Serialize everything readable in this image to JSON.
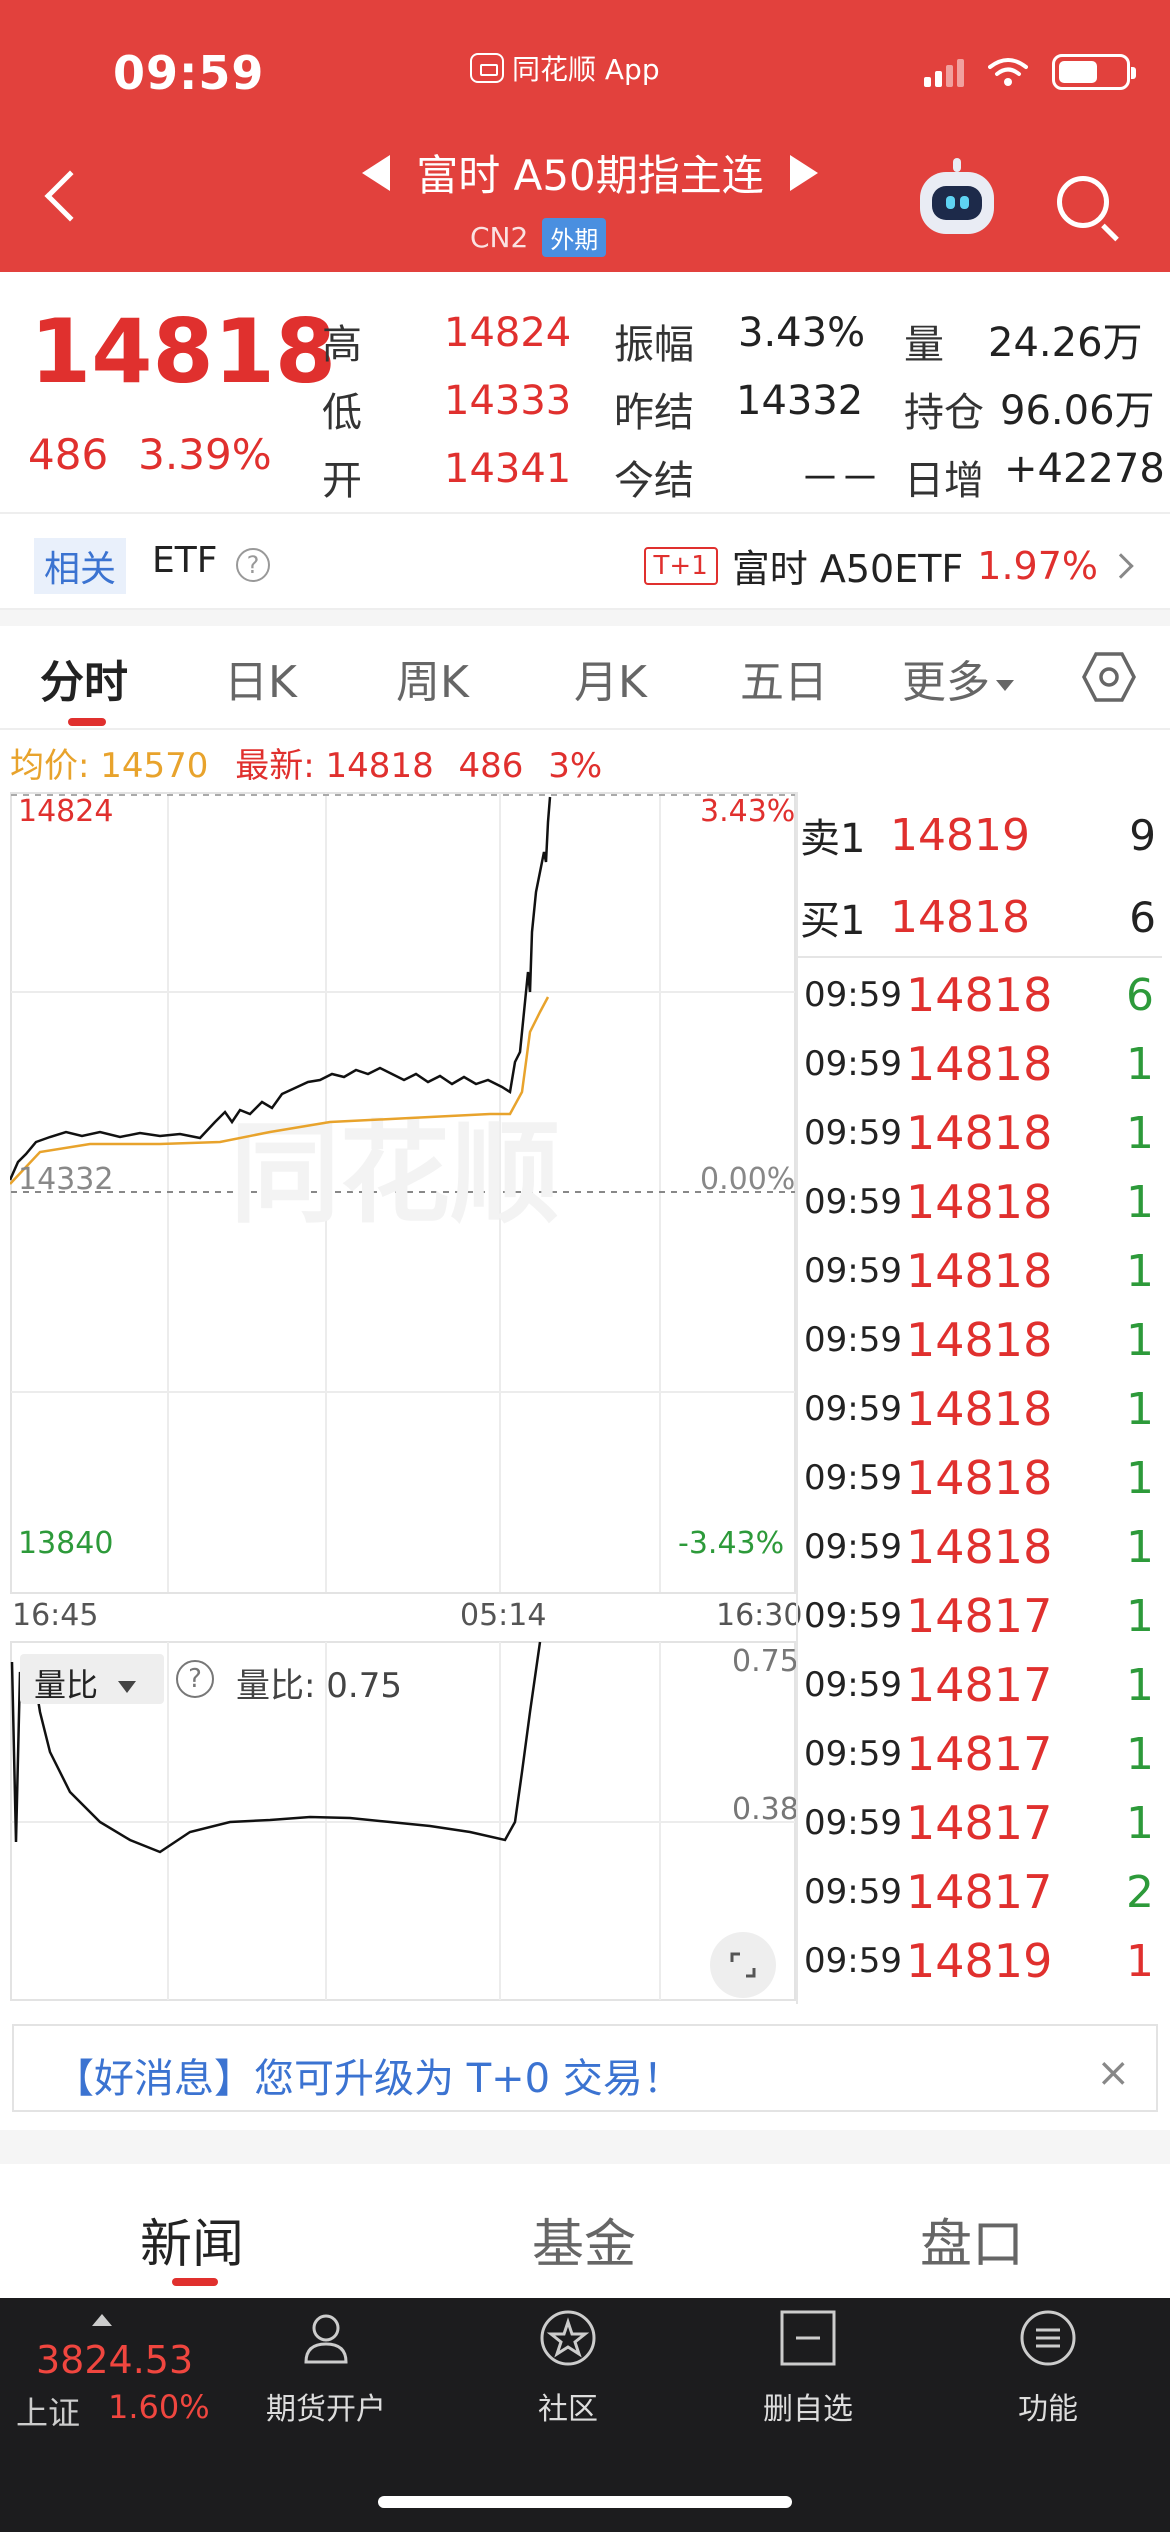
{
  "status": {
    "time": "09:59",
    "app": "同花顺 App"
  },
  "nav": {
    "title": "富时 A50期指主连",
    "code": "CN2",
    "tag": "外期"
  },
  "quote": {
    "price": "14818",
    "change": "486",
    "change_pct": "3.39%",
    "high_label": "高",
    "high": "14824",
    "low_label": "低",
    "low": "14333",
    "open_label": "开",
    "open": "14341",
    "amp_label": "振幅",
    "amp": "3.43%",
    "prev_settle_label": "昨结",
    "prev_settle": "14332",
    "today_settle_label": "今结",
    "today_settle": "－－",
    "vol_label": "量",
    "vol": "24.26万",
    "oi_label": "持仓",
    "oi": "96.06万",
    "daily_inc_label": "日增",
    "daily_inc": "+42278"
  },
  "etf": {
    "related": "相关",
    "label": "ETF",
    "help": "?",
    "tag": "T+1",
    "name": "富时 A50ETF",
    "pct": "1.97%"
  },
  "tabs": [
    "分时",
    "日K",
    "周K",
    "月K",
    "五日",
    "更多"
  ],
  "avg": {
    "avg_label": "均价:",
    "avg": "14570",
    "latest_label": "最新:",
    "latest": "14818",
    "chg": "486",
    "pct": "3%"
  },
  "chart": {
    "y_top": "14824",
    "y_mid": "14332",
    "y_bottom": "13840",
    "pct_top": "3.43%",
    "pct_mid": "0.00%",
    "pct_bottom": "-3.43%",
    "x_start": "16:45",
    "x_mid": "05:14",
    "x_end": "16:30",
    "ratio_label": "量比",
    "ratio_text": "量比: 0.75",
    "ratio_top": "0.75",
    "ratio_mid": "0.38",
    "watermark": "同花顺"
  },
  "book": {
    "sell_label": "卖1",
    "sell_price": "14819",
    "sell_vol": "9",
    "buy_label": "买1",
    "buy_price": "14818",
    "buy_vol": "6"
  },
  "ticks": [
    {
      "time": "09:59",
      "price": "14818",
      "vol": "6",
      "dir": "green"
    },
    {
      "time": "09:59",
      "price": "14818",
      "vol": "1",
      "dir": "green"
    },
    {
      "time": "09:59",
      "price": "14818",
      "vol": "1",
      "dir": "green"
    },
    {
      "time": "09:59",
      "price": "14818",
      "vol": "1",
      "dir": "green"
    },
    {
      "time": "09:59",
      "price": "14818",
      "vol": "1",
      "dir": "green"
    },
    {
      "time": "09:59",
      "price": "14818",
      "vol": "1",
      "dir": "green"
    },
    {
      "time": "09:59",
      "price": "14818",
      "vol": "1",
      "dir": "green"
    },
    {
      "time": "09:59",
      "price": "14818",
      "vol": "1",
      "dir": "green"
    },
    {
      "time": "09:59",
      "price": "14818",
      "vol": "1",
      "dir": "green"
    },
    {
      "time": "09:59",
      "price": "14817",
      "vol": "1",
      "dir": "green"
    },
    {
      "time": "09:59",
      "price": "14817",
      "vol": "1",
      "dir": "green"
    },
    {
      "time": "09:59",
      "price": "14817",
      "vol": "1",
      "dir": "green"
    },
    {
      "time": "09:59",
      "price": "14817",
      "vol": "1",
      "dir": "green"
    },
    {
      "time": "09:59",
      "price": "14817",
      "vol": "2",
      "dir": "green"
    },
    {
      "time": "09:59",
      "price": "14819",
      "vol": "1",
      "dir": "red"
    }
  ],
  "notice": {
    "text": "【好消息】您可升级为 T+0 交易！",
    "close": "×"
  },
  "news_tabs": [
    "新闻",
    "基金",
    "盘口"
  ],
  "bottom": {
    "index_value": "3824.53",
    "index_name": "上证",
    "index_pct": "1.60%",
    "items": [
      "期货开户",
      "社区",
      "删自选",
      "功能"
    ]
  },
  "colors": {
    "header": "#e2413d",
    "up": "#e0302e",
    "down": "#2d9a3a",
    "avg_line": "#e8a32c",
    "link": "#3b73d1"
  }
}
